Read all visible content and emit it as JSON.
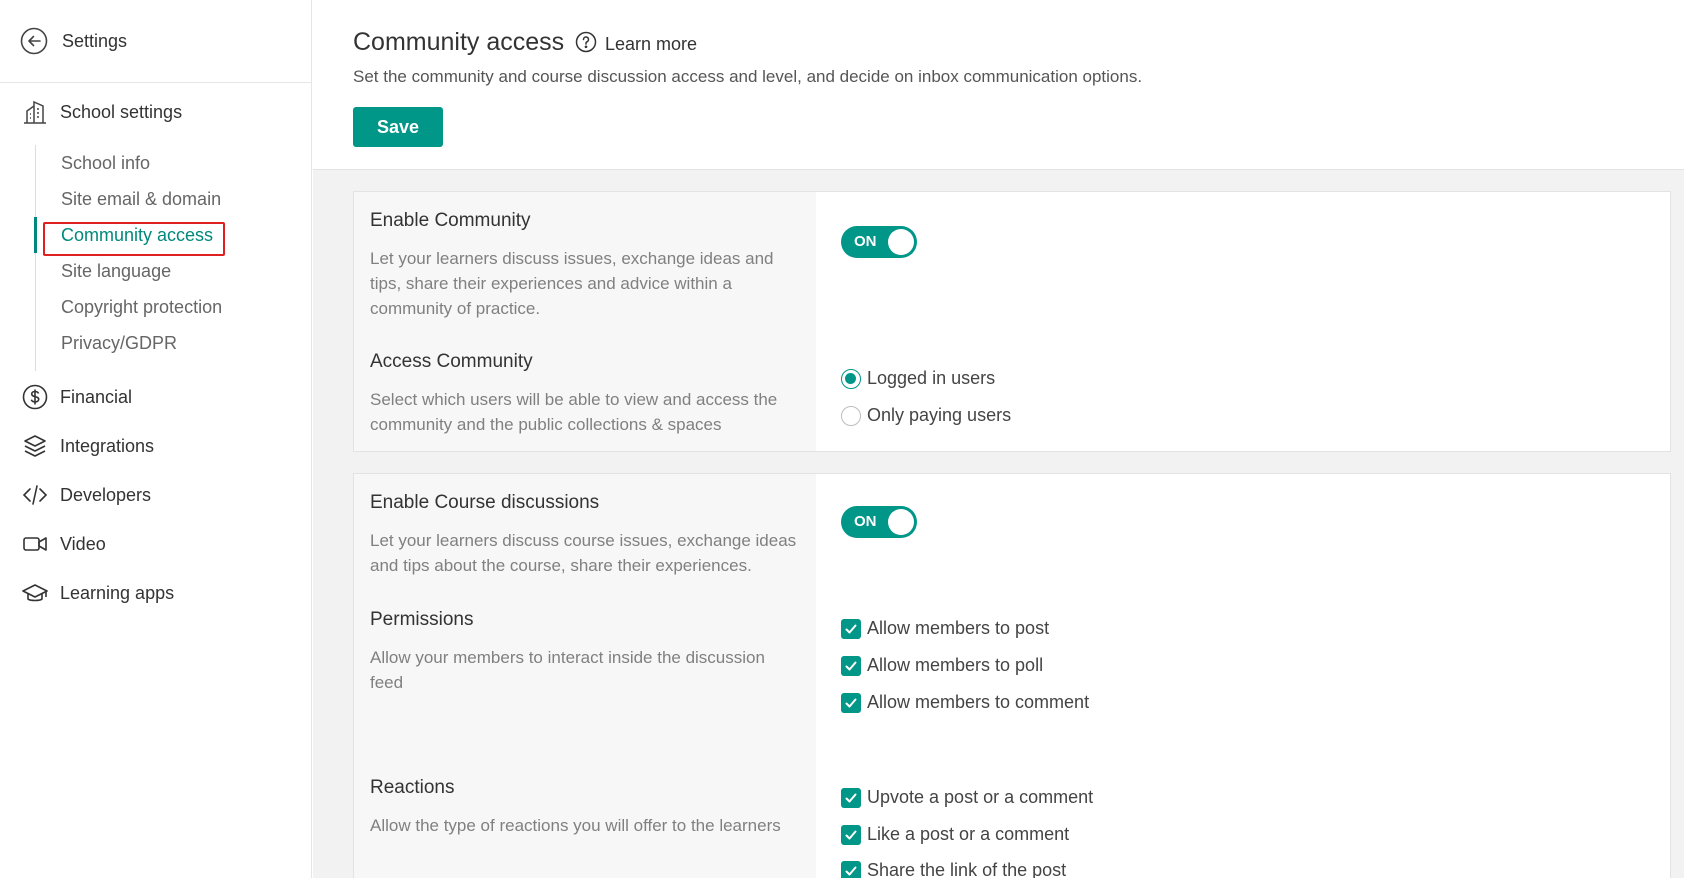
{
  "sidebar": {
    "header_title": "Settings",
    "school_settings": "School settings",
    "sub_items": [
      "School info",
      "Site email & domain",
      "Community access",
      "Site language",
      "Copyright protection",
      "Privacy/GDPR"
    ],
    "sections": [
      "Financial",
      "Integrations",
      "Developers",
      "Video",
      "Learning apps"
    ]
  },
  "header": {
    "title": "Community access",
    "learn_more": "Learn more",
    "subtitle": "Set the community and course discussion access and level, and decide on inbox communication options.",
    "save_label": "Save"
  },
  "community": {
    "enable_title": "Enable Community",
    "enable_desc": "Let your learners discuss issues, exchange ideas and tips, share their experiences and advice within a community of practice.",
    "toggle_label": "ON",
    "access_title": "Access Community",
    "access_desc": "Select which users will be able to view and access the community and the public collections & spaces",
    "access_options": [
      "Logged in users",
      "Only paying users"
    ],
    "access_selected": "Logged in users"
  },
  "course": {
    "enable_title": "Enable Course discussions",
    "enable_desc": "Let your learners discuss course issues, exchange ideas and tips about the course, share their experiences.",
    "toggle_label": "ON",
    "permissions_title": "Permissions",
    "permissions_desc": "Allow your members to interact inside the discussion feed",
    "permissions": [
      "Allow members to post",
      "Allow members to poll",
      "Allow members to comment"
    ],
    "reactions_title": "Reactions",
    "reactions_desc": "Allow the type of reactions you will offer to the learners",
    "reactions": [
      "Upvote a post or a comment",
      "Like a post or a comment",
      "Share the link of the post"
    ]
  },
  "colors": {
    "accent": "#009688",
    "highlight": "#e02020"
  },
  "icons": [
    "back-arrow-icon",
    "building-icon",
    "dollar-icon",
    "layers-icon",
    "code-icon",
    "video-icon",
    "graduation-cap-icon",
    "help-circle-icon",
    "check-icon"
  ]
}
